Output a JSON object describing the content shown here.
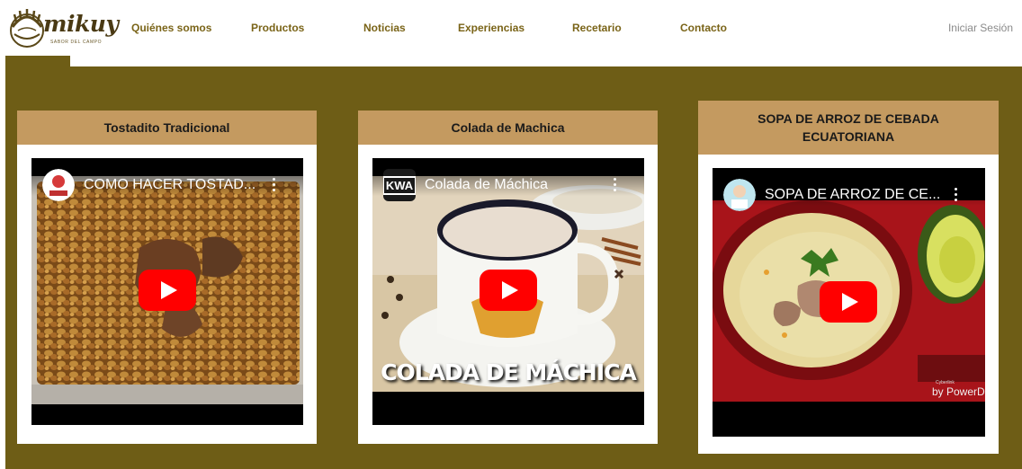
{
  "brand": {
    "name": "mikuy",
    "tagline": "SABOR DEL CAMPO"
  },
  "nav": {
    "items": [
      "Quiénes somos",
      "Productos",
      "Noticias",
      "Experiencias",
      "Recetario",
      "Contacto"
    ],
    "login": "Iniciar Sesión"
  },
  "cards": [
    {
      "title": "Tostadito Tradicional",
      "video_title": "COMO HACER TOSTAD...",
      "channel_icon": "channel-avatar-icon"
    },
    {
      "title": "Colada de Machica",
      "video_title": "Colada de Máchica",
      "channel_badge": "KWA",
      "overlay_text": "COLADA DE MÁCHICA"
    },
    {
      "title": "SOPA DE ARROZ DE CEBADA ECUATORIANA",
      "video_title": "SOPA DE ARROZ DE CE...",
      "channel_icon": "channel-avatar-icon",
      "watermark_small": "Cyberlink",
      "watermark": "by PowerD"
    }
  ],
  "colors": {
    "band": "#6e5d16",
    "card_header": "#c49a60",
    "nav_text": "#7a6418",
    "play_red": "#ff0000"
  }
}
